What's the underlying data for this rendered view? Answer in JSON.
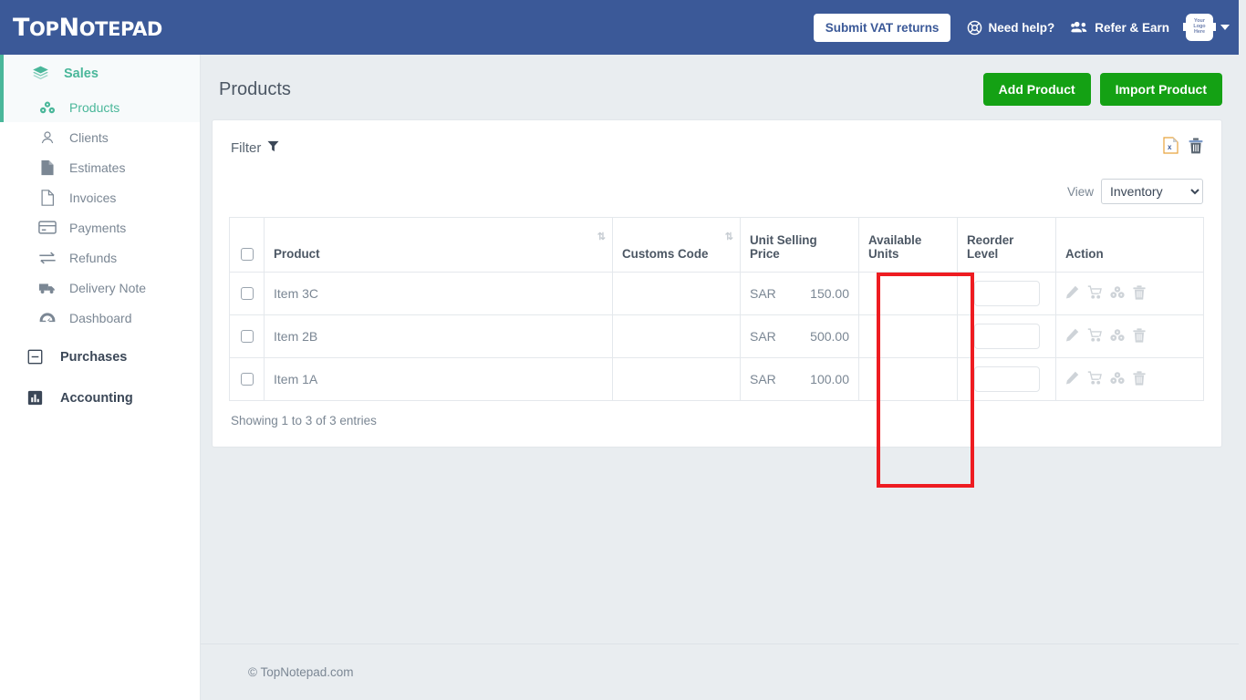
{
  "header": {
    "brand_top": "T",
    "brand": "TopNotepad",
    "vat_button": "Submit VAT returns",
    "need_help": "Need help?",
    "refer_earn": "Refer & Earn",
    "avatar_line1": "Your",
    "avatar_line2": "Logo",
    "avatar_line3": "Here",
    "bg_color": "#3b5998"
  },
  "sidebar": {
    "group": {
      "label": "Sales",
      "icon": "layers-icon"
    },
    "items": [
      {
        "label": "Products",
        "icon": "cubes-icon",
        "active": true
      },
      {
        "label": "Clients",
        "icon": "user-icon",
        "active": false
      },
      {
        "label": "Estimates",
        "icon": "file-filled-icon",
        "active": false
      },
      {
        "label": "Invoices",
        "icon": "file-icon",
        "active": false
      },
      {
        "label": "Payments",
        "icon": "credit-card-icon",
        "active": false
      },
      {
        "label": "Refunds",
        "icon": "exchange-icon",
        "active": false
      },
      {
        "label": "Delivery Note",
        "icon": "truck-icon",
        "active": false
      },
      {
        "label": "Dashboard",
        "icon": "gauge-icon",
        "active": false
      }
    ],
    "sections": [
      {
        "label": "Purchases",
        "icon": "minus-square-icon"
      },
      {
        "label": "Accounting",
        "icon": "bar-chart-icon"
      }
    ],
    "accent_color": "#4ab79a"
  },
  "page": {
    "title": "Products",
    "add_button": "Add Product",
    "import_button": "Import Product",
    "button_color": "#14a114"
  },
  "card": {
    "filter_label": "Filter",
    "export_icon": "excel-export-icon",
    "delete_icon": "trash-icon",
    "view_label": "View",
    "view_value": "Inventory",
    "view_options": [
      "Inventory"
    ]
  },
  "table": {
    "columns": [
      {
        "label": "",
        "key": "checkbox"
      },
      {
        "label": "Product",
        "key": "product",
        "sortable": true
      },
      {
        "label": "Customs Code",
        "key": "customs_code",
        "sortable": true
      },
      {
        "label": "Unit Selling Price",
        "key": "price"
      },
      {
        "label": "Available Units",
        "key": "available_units"
      },
      {
        "label": "Reorder Level",
        "key": "reorder_level"
      },
      {
        "label": "Action",
        "key": "action"
      }
    ],
    "rows": [
      {
        "product": "Item 3C",
        "customs_code": "",
        "currency": "SAR",
        "amount": "150.00",
        "available_units": "",
        "reorder_level": ""
      },
      {
        "product": "Item 2B",
        "customs_code": "",
        "currency": "SAR",
        "amount": "500.00",
        "available_units": "",
        "reorder_level": ""
      },
      {
        "product": "Item 1A",
        "customs_code": "",
        "currency": "SAR",
        "amount": "100.00",
        "available_units": "",
        "reorder_level": ""
      }
    ],
    "row_actions": [
      "edit-pencil-icon",
      "cart-plus-icon",
      "cubes-icon",
      "trash-icon"
    ],
    "showing": "Showing 1 to 3 of 3 entries"
  },
  "annotation": {
    "highlight_color": "#ee1c21",
    "highlight_target": "Available Units"
  },
  "footer": {
    "copyright": "© TopNotepad.com"
  }
}
